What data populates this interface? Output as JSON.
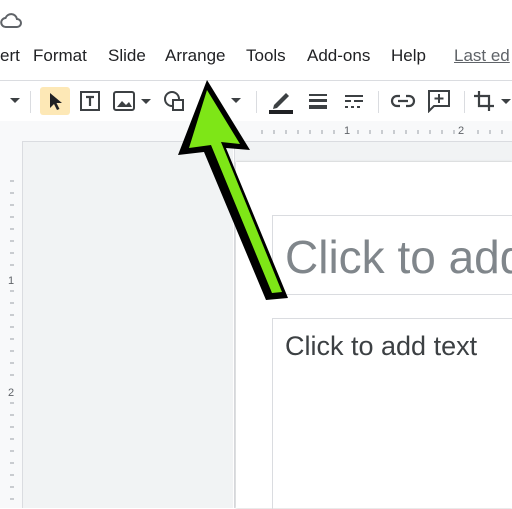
{
  "menu": {
    "items": [
      "ert",
      "Format",
      "Slide",
      "Arrange",
      "Tools",
      "Add-ons",
      "Help"
    ],
    "last_edit": "Last ed"
  },
  "ruler": {
    "h_labels": [
      "1",
      "2"
    ],
    "v_labels": [
      "1",
      "2"
    ]
  },
  "slide": {
    "title_placeholder": "Click to add",
    "body_placeholder": "Click to add text"
  },
  "icons": {
    "cloud": "cloud-status-icon",
    "select": "select-cursor-icon",
    "textbox": "text-box-icon",
    "image": "insert-image-icon",
    "shape": "shape-icon",
    "line_color": "line-color-icon",
    "line_weight": "line-weight-icon",
    "line_dash": "line-dash-icon",
    "link": "insert-link-icon",
    "comment": "add-comment-icon",
    "crop": "crop-icon"
  },
  "colors": {
    "annotation_arrow": "#7ee617",
    "selected_tool": "#fde8b6"
  }
}
